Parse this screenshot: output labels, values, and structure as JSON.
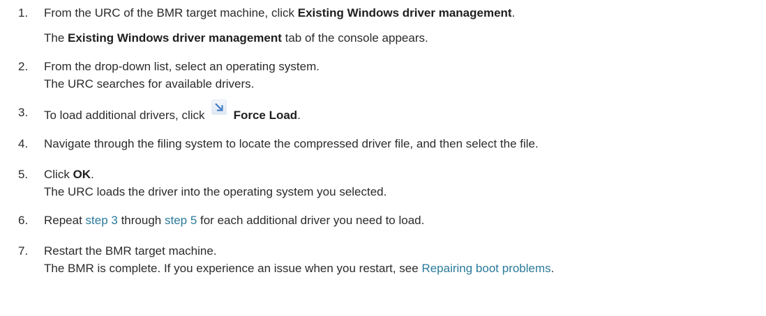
{
  "steps": [
    {
      "number": "1.",
      "text_before": "From the URC of the BMR target machine, click ",
      "bold": "Existing Windows driver management",
      "text_after": ".",
      "result_bold": "Existing Windows driver management",
      "result_after": " tab of the console appears.",
      "result_before": "The "
    },
    {
      "number": "2.",
      "text": "From the drop-down list, select an operating system.",
      "result": "The URC searches for available drivers."
    },
    {
      "number": "3.",
      "text_before": "To load additional drivers, click",
      "icon": "force-load-icon",
      "bold": "Force Load",
      "text_after": "."
    },
    {
      "number": "4.",
      "text": "Navigate through the filing system to locate the compressed driver file, and then select the file."
    },
    {
      "number": "5.",
      "text_before": "Click ",
      "bold": "OK",
      "text_after": ".",
      "result": "The URC loads the driver into the operating system you selected."
    },
    {
      "number": "6.",
      "text_before": "Repeat ",
      "link1": "step 3",
      "text_middle": " through ",
      "link2": "step 5",
      "text_after": " for each additional driver you need to load."
    },
    {
      "number": "7.",
      "text": "Restart the BMR target machine.",
      "result_before": "The BMR is complete. If you experience an issue when you restart, see ",
      "result_link": "Repairing boot problems",
      "result_after": "."
    }
  ],
  "colors": {
    "text": "#2b2b2b",
    "link": "#2b7a9b",
    "icon_arrow": "#3a78c2"
  }
}
